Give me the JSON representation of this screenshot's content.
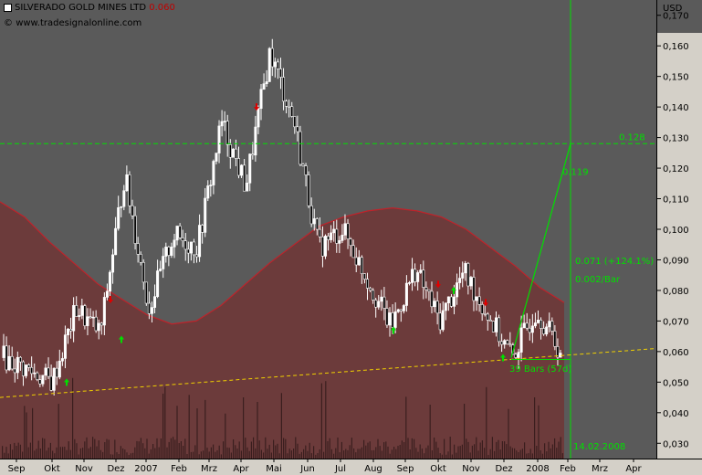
{
  "header": {
    "title": "SILVERADO GOLD MINES LTD",
    "price": "0.060",
    "source": "www.tradesignalonline.com",
    "currency": "USD"
  },
  "colors": {
    "background": "#5a5a5a",
    "band_fill": "#6e3a3a",
    "band_line": "#c0222a",
    "candles": "#ffffff",
    "buy_arrow": "#00e000",
    "sell_arrow": "#e00000",
    "trend_lines": "#00e000",
    "support_line": "#f0d000"
  },
  "annotations": {
    "hline_label": "0.128",
    "target_label": "0.119",
    "gain_label": "0.071 (+124.1%)",
    "rate_label": "0.002/Bar",
    "bars_label": "39 Bars (57d)",
    "date_label": "14.02.2008"
  },
  "chart_data": {
    "type": "candlestick",
    "title": "SILVERADO GOLD MINES LTD",
    "ylabel": "USD",
    "ylim": [
      0.025,
      0.175
    ],
    "yticks": [
      "0,030",
      "0,040",
      "0,050",
      "0,060",
      "0,070",
      "0,080",
      "0,090",
      "0,100",
      "0,110",
      "0,120",
      "0,130",
      "0,140",
      "0,150",
      "0,160",
      "0,170"
    ],
    "yvalues": [
      0.03,
      0.04,
      0.05,
      0.06,
      0.07,
      0.08,
      0.09,
      0.1,
      0.11,
      0.12,
      0.13,
      0.14,
      0.15,
      0.16,
      0.17
    ],
    "xticks": [
      "Sep",
      "Okt",
      "Nov",
      "Dez",
      "2007",
      "Feb",
      "Mrz",
      "Apr",
      "Mai",
      "Jun",
      "Jul",
      "Aug",
      "Sep",
      "Okt",
      "Nov",
      "Dez",
      "2008",
      "Feb",
      "Mrz",
      "Apr"
    ],
    "price_path": [
      {
        "date": "2006-09",
        "close": 0.058
      },
      {
        "date": "2006-10",
        "close": 0.054
      },
      {
        "date": "2006-10-25",
        "close": 0.05
      },
      {
        "date": "2006-11",
        "close": 0.074
      },
      {
        "date": "2006-12",
        "close": 0.066
      },
      {
        "date": "2006-12-20",
        "close": 0.118
      },
      {
        "date": "2007-01",
        "close": 0.074
      },
      {
        "date": "2007-01-20",
        "close": 0.098
      },
      {
        "date": "2007-02",
        "close": 0.094
      },
      {
        "date": "2007-02-20",
        "close": 0.135
      },
      {
        "date": "2007-03",
        "close": 0.114
      },
      {
        "date": "2007-04",
        "close": 0.158
      },
      {
        "date": "2007-04-20",
        "close": 0.135
      },
      {
        "date": "2007-05",
        "close": 0.094
      },
      {
        "date": "2007-06",
        "close": 0.1
      },
      {
        "date": "2007-07",
        "close": 0.084
      },
      {
        "date": "2007-08",
        "close": 0.068
      },
      {
        "date": "2007-09",
        "close": 0.087
      },
      {
        "date": "2007-10",
        "close": 0.07
      },
      {
        "date": "2007-10-20",
        "close": 0.086
      },
      {
        "date": "2007-11",
        "close": 0.072
      },
      {
        "date": "2007-12",
        "close": 0.058
      },
      {
        "date": "2008-01",
        "close": 0.074
      },
      {
        "date": "2008-02",
        "close": 0.06
      }
    ],
    "horizontal_line": 0.128,
    "trend_projection": {
      "from": 0.058,
      "to": 0.128,
      "gain": "0.071 (+124.1%)",
      "rate": "0.002/Bar",
      "bars": "39 Bars (57d)"
    },
    "support_line": {
      "from": 0.045,
      "to": 0.061
    },
    "band_upper": [
      0.109,
      0.104,
      0.096,
      0.089,
      0.082,
      0.077,
      0.072,
      0.069,
      0.07,
      0.075,
      0.082,
      0.089,
      0.095,
      0.101,
      0.104,
      0.106,
      0.107,
      0.106,
      0.104,
      0.1,
      0.094,
      0.088,
      0.081,
      0.076
    ],
    "date_marker": "14.02.2008",
    "grid": false,
    "legend": "none"
  }
}
